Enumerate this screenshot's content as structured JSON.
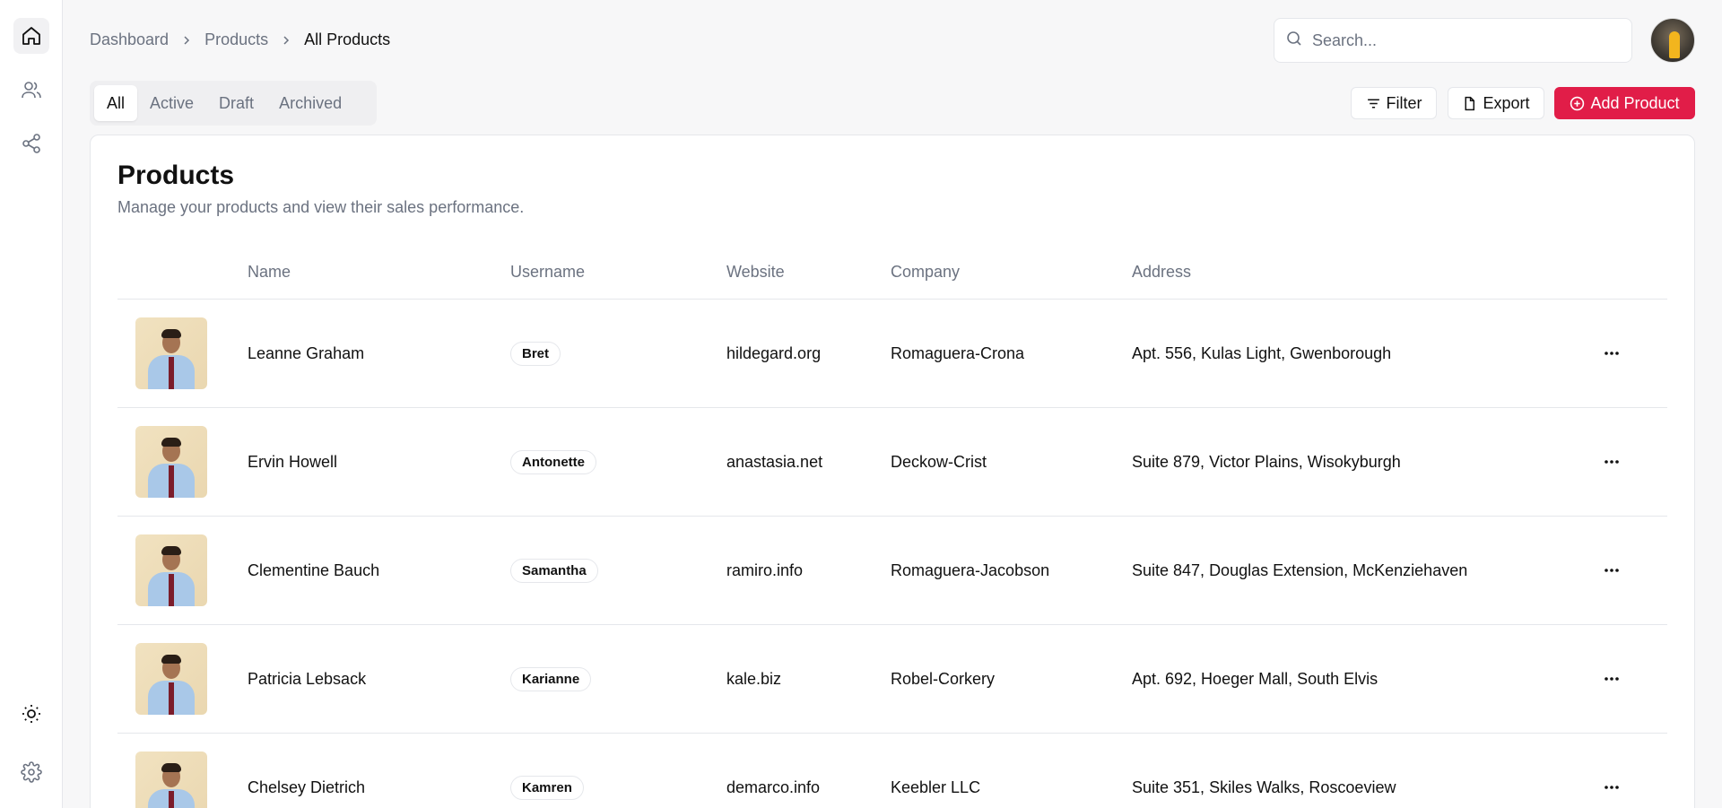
{
  "sidebar": {
    "icons": [
      "home-icon",
      "users-icon",
      "share-icon",
      "sun-icon",
      "settings-icon"
    ]
  },
  "breadcrumb": [
    "Dashboard",
    "Products",
    "All Products"
  ],
  "search": {
    "placeholder": "Search..."
  },
  "tabs": [
    "All",
    "Active",
    "Draft",
    "Archived"
  ],
  "actions": {
    "filter": "Filter",
    "export": "Export",
    "add": "Add Product"
  },
  "card": {
    "title": "Products",
    "description": "Manage your products and view their sales performance."
  },
  "table": {
    "columns": [
      "Name",
      "Username",
      "Website",
      "Company",
      "Address"
    ],
    "rows": [
      {
        "name": "Leanne Graham",
        "username": "Bret",
        "website": "hildegard.org",
        "company": "Romaguera-Crona",
        "address": "Apt. 556, Kulas Light, Gwenborough"
      },
      {
        "name": "Ervin Howell",
        "username": "Antonette",
        "website": "anastasia.net",
        "company": "Deckow-Crist",
        "address": "Suite 879, Victor Plains, Wisokyburgh"
      },
      {
        "name": "Clementine Bauch",
        "username": "Samantha",
        "website": "ramiro.info",
        "company": "Romaguera-Jacobson",
        "address": "Suite 847, Douglas Extension, McKenziehaven"
      },
      {
        "name": "Patricia Lebsack",
        "username": "Karianne",
        "website": "kale.biz",
        "company": "Robel-Corkery",
        "address": "Apt. 692, Hoeger Mall, South Elvis"
      },
      {
        "name": "Chelsey Dietrich",
        "username": "Kamren",
        "website": "demarco.info",
        "company": "Keebler LLC",
        "address": "Suite 351, Skiles Walks, Roscoeview"
      }
    ]
  },
  "colors": {
    "accent": "#e11d48",
    "muted": "#6b7280",
    "border": "#e5e7eb"
  }
}
